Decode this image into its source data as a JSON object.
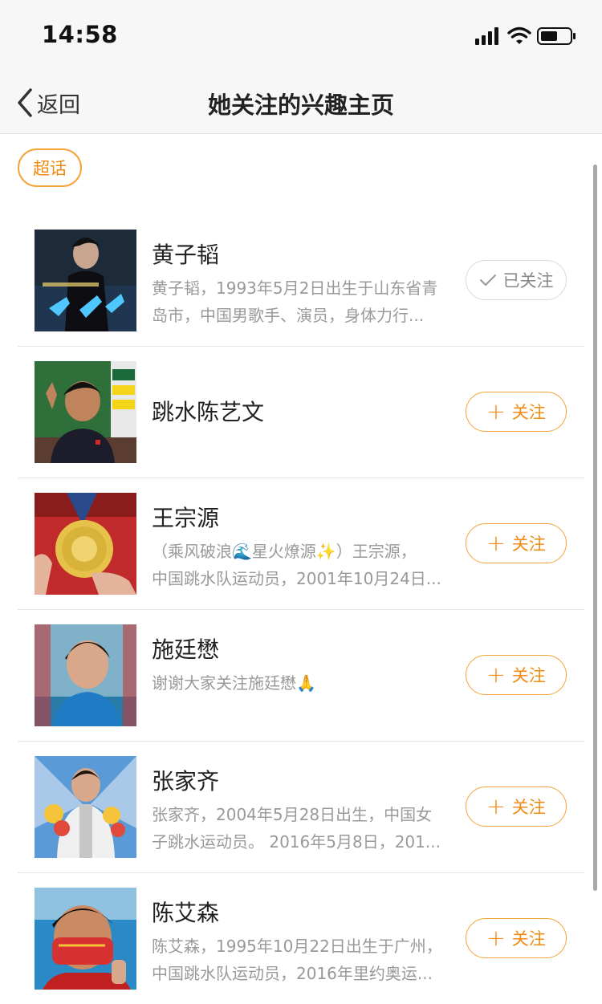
{
  "status": {
    "time": "14:58"
  },
  "nav": {
    "back_label": "返回",
    "title": "她关注的兴趣主页"
  },
  "filter_tag": "超话",
  "items": [
    {
      "name": "黄子韬",
      "desc1": "黄子韬，1993年5月2日出生于山东省青",
      "desc2": "岛市，中国男歌手、演员，身体力行...",
      "button": "已关注",
      "followed": true
    },
    {
      "name": "跳水陈艺文",
      "desc1": "",
      "desc2": "",
      "button": "关注",
      "followed": false
    },
    {
      "name": "王宗源",
      "desc1": "（乘风破浪🌊星火燎源✨）王宗源，",
      "desc2": "中国跳水队运动员，2001年10月24日...",
      "button": "关注",
      "followed": false
    },
    {
      "name": "施廷懋",
      "desc1": "谢谢大家关注施廷懋🙏",
      "desc2": "",
      "button": "关注",
      "followed": false
    },
    {
      "name": "张家齐",
      "desc1": "张家齐，2004年5月28日出生，中国女",
      "desc2": "子跳水运动员。 2016年5月8日，201...",
      "button": "关注",
      "followed": false
    },
    {
      "name": "陈艾森",
      "desc1": "陈艾森，1995年10月22日出生于广州，",
      "desc2": "中国跳水队运动员，2016年里约奥运...",
      "button": "关注",
      "followed": false
    }
  ],
  "colors": {
    "accent": "#f08a10",
    "accent_border": "#f5a33a",
    "muted": "#999999"
  }
}
